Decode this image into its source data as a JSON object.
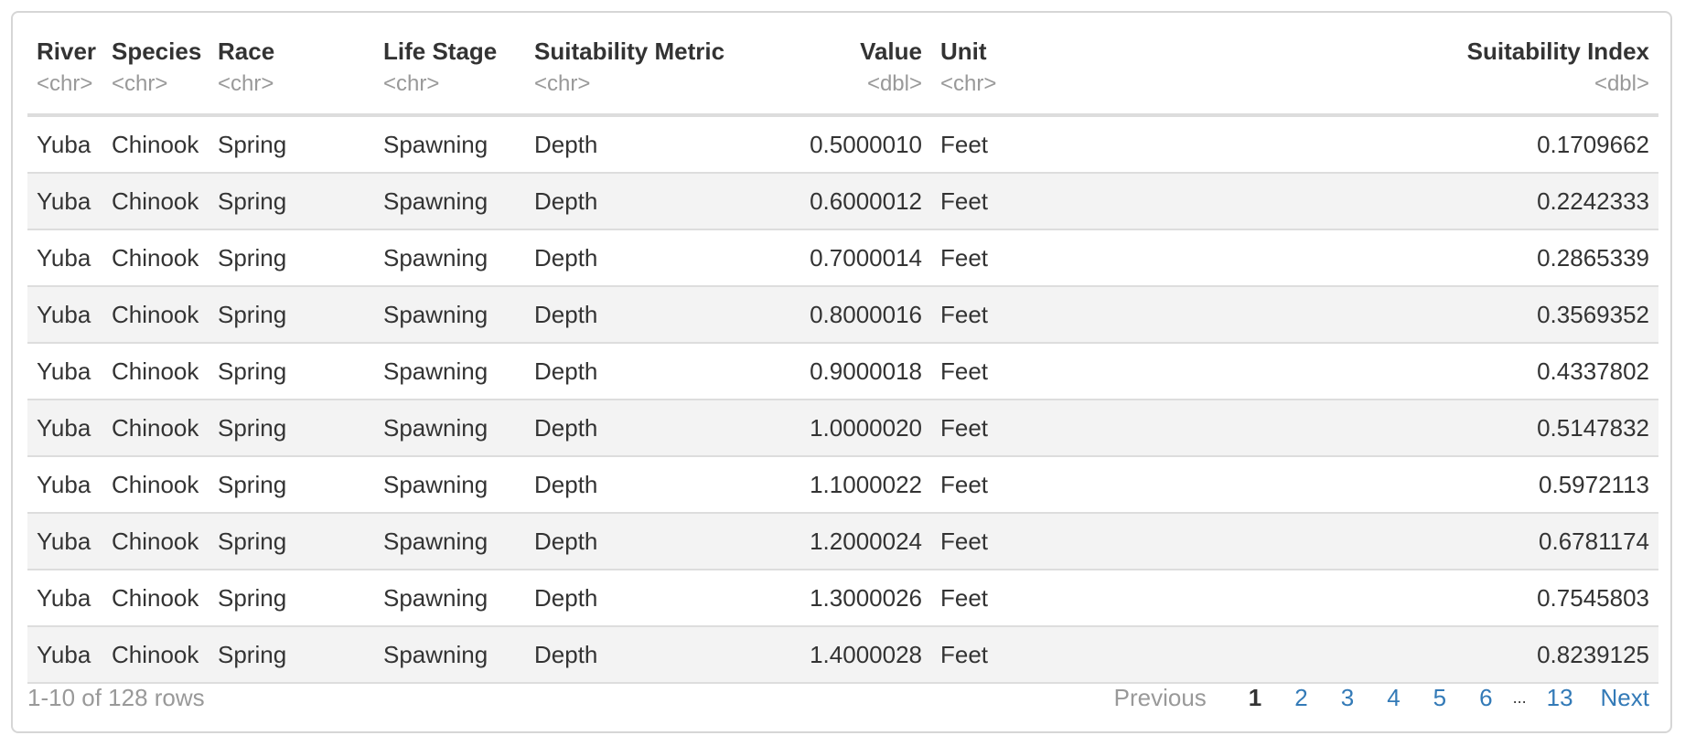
{
  "table": {
    "columns": [
      {
        "label": "River",
        "type": "<chr>"
      },
      {
        "label": "Species",
        "type": "<chr>"
      },
      {
        "label": "Race",
        "type": "<chr>"
      },
      {
        "label": "Life Stage",
        "type": "<chr>"
      },
      {
        "label": "Suitability Metric",
        "type": "<chr>"
      },
      {
        "label": "Value",
        "type": "<dbl>"
      },
      {
        "label": "Unit",
        "type": "<chr>"
      },
      {
        "label": "Suitability Index",
        "type": "<dbl>"
      }
    ],
    "rows": [
      [
        "Yuba",
        "Chinook",
        "Spring",
        "Spawning",
        "Depth",
        "0.5000010",
        "Feet",
        "0.1709662"
      ],
      [
        "Yuba",
        "Chinook",
        "Spring",
        "Spawning",
        "Depth",
        "0.6000012",
        "Feet",
        "0.2242333"
      ],
      [
        "Yuba",
        "Chinook",
        "Spring",
        "Spawning",
        "Depth",
        "0.7000014",
        "Feet",
        "0.2865339"
      ],
      [
        "Yuba",
        "Chinook",
        "Spring",
        "Spawning",
        "Depth",
        "0.8000016",
        "Feet",
        "0.3569352"
      ],
      [
        "Yuba",
        "Chinook",
        "Spring",
        "Spawning",
        "Depth",
        "0.9000018",
        "Feet",
        "0.4337802"
      ],
      [
        "Yuba",
        "Chinook",
        "Spring",
        "Spawning",
        "Depth",
        "1.0000020",
        "Feet",
        "0.5147832"
      ],
      [
        "Yuba",
        "Chinook",
        "Spring",
        "Spawning",
        "Depth",
        "1.1000022",
        "Feet",
        "0.5972113"
      ],
      [
        "Yuba",
        "Chinook",
        "Spring",
        "Spawning",
        "Depth",
        "1.2000024",
        "Feet",
        "0.6781174"
      ],
      [
        "Yuba",
        "Chinook",
        "Spring",
        "Spawning",
        "Depth",
        "1.3000026",
        "Feet",
        "0.7545803"
      ],
      [
        "Yuba",
        "Chinook",
        "Spring",
        "Spawning",
        "Depth",
        "1.4000028",
        "Feet",
        "0.8239125"
      ]
    ]
  },
  "footer": {
    "row_info": "1-10 of 128 rows",
    "previous_label": "Previous",
    "pages": [
      "1",
      "2",
      "3",
      "4",
      "5",
      "6"
    ],
    "ellipsis": "...",
    "last_page": "13",
    "next_label": "Next",
    "current_page": "1"
  },
  "colors": {
    "link": "#337ab7",
    "muted": "#999999",
    "stripe": "#f3f3f3",
    "border": "#dddddd"
  }
}
